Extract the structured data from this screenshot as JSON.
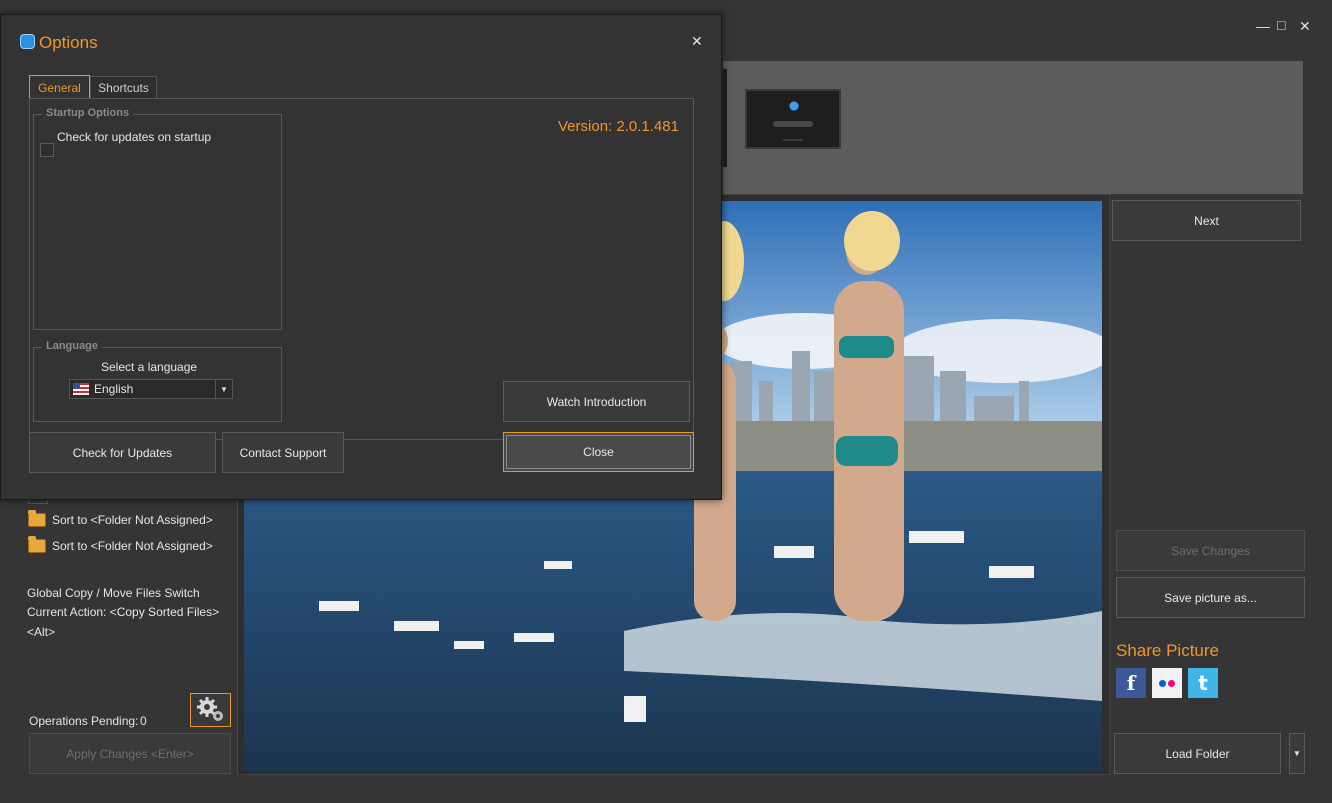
{
  "window": {
    "minimize_icon": "minimize-icon",
    "maximize_icon": "maximize-icon",
    "close_icon": "close-icon"
  },
  "right_panel": {
    "next_label": "Next",
    "save_changes_label": "Save Changes",
    "save_picture_as_label": "Save picture as...",
    "share_title": "Share Picture",
    "share": [
      {
        "name": "facebook",
        "glyph": "f",
        "color": "#3b5998"
      },
      {
        "name": "flickr",
        "glyph": "●●",
        "color": "#f2f2f2"
      },
      {
        "name": "twitter",
        "glyph": "t",
        "color": "#3fb6e8"
      }
    ],
    "load_folder_label": "Load Folder",
    "load_folder_dropdown_icon": "chevron-down-icon"
  },
  "left_panel": {
    "sort_rows": [
      {
        "label": "Sort to <Folder Not Assigned>"
      },
      {
        "label": "Sort to <Folder Not Assigned>"
      }
    ],
    "switch_line1": "Global Copy / Move Files Switch",
    "switch_line2": "Current Action: <Copy Sorted Files>",
    "switch_line3": "<Alt>",
    "ops_pending_label": "Operations Pending:",
    "ops_pending_count": "0",
    "apply_label": "Apply Changes <Enter>"
  },
  "dialog": {
    "title": "Options",
    "tabs": [
      {
        "label": "General",
        "active": true
      },
      {
        "label": "Shortcuts",
        "active": false
      }
    ],
    "startup_group_label": "Startup Options",
    "check_updates_on_startup_label": "Check for updates on startup",
    "check_updates_on_startup_checked": false,
    "version_text": "Version: 2.0.1.481",
    "language_group_label": "Language",
    "select_language_label": "Select a language",
    "language_value": "English",
    "watch_intro_label": "Watch Introduction",
    "check_updates_label": "Check for Updates",
    "contact_support_label": "Contact Support",
    "close_label": "Close"
  },
  "colors": {
    "accent": "#f0962a",
    "background": "#353535",
    "button": "#3a3a3a"
  }
}
